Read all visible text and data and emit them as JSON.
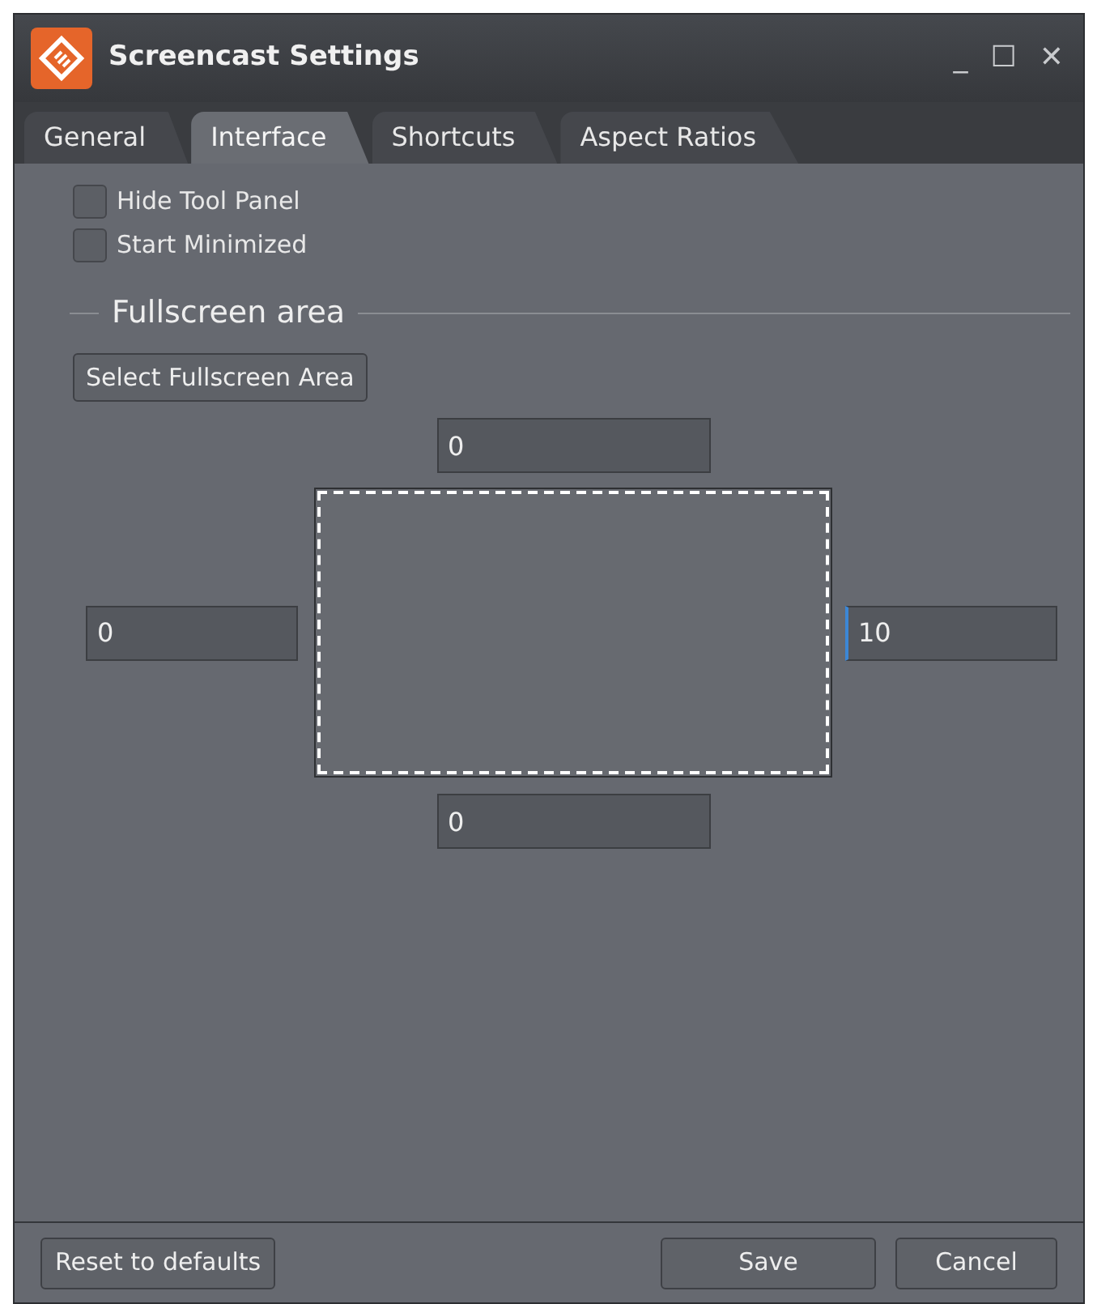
{
  "window": {
    "title": "Screencast Settings",
    "controls": [
      "_",
      "☐",
      "✕"
    ]
  },
  "tabs": [
    {
      "label": "General",
      "selected": false
    },
    {
      "label": "Interface",
      "selected": true
    },
    {
      "label": "Shortcuts",
      "selected": false
    },
    {
      "label": "Aspect Ratios",
      "selected": false
    }
  ],
  "options": [
    {
      "label": "Hide Tool Panel",
      "checked": false
    },
    {
      "label": "Start Minimized",
      "checked": false
    }
  ],
  "fullscreen_area": {
    "heading": "Fullscreen area",
    "select_button": "Select Fullscreen Area",
    "top": {
      "value": "0",
      "focused": false
    },
    "left": {
      "value": "0",
      "focused": false
    },
    "right": {
      "value": "10",
      "focused": true
    },
    "bottom": {
      "value": "0",
      "focused": false
    }
  },
  "footer": {
    "reset": "Reset to defaults",
    "save": "Save",
    "cancel": "Cancel"
  }
}
